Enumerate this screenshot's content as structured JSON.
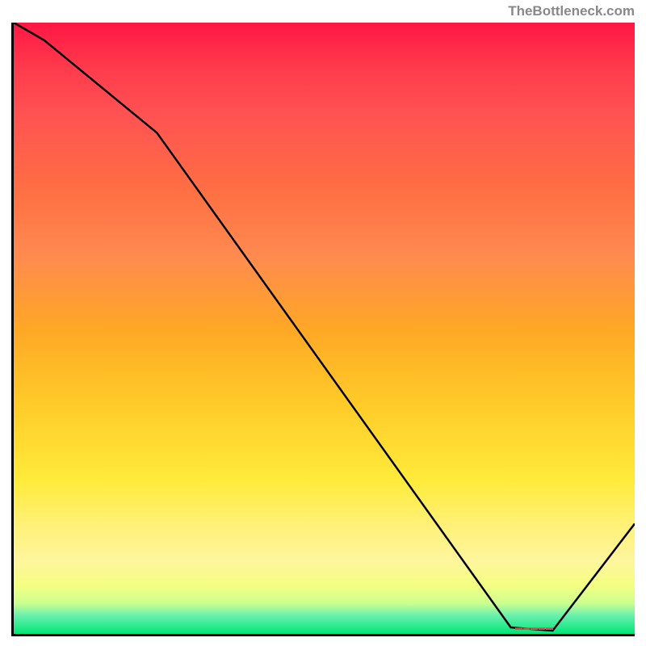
{
  "watermark": "TheBottleneck.com",
  "marker_text": "▬▬▬▬▬",
  "chart_data": {
    "type": "line",
    "title": "",
    "xlabel": "",
    "ylabel": "",
    "x": [
      0,
      5,
      23,
      80,
      87,
      100
    ],
    "values": [
      100,
      97,
      82,
      1,
      0.5,
      18
    ],
    "xlim": [
      0,
      100
    ],
    "ylim": [
      0,
      100
    ],
    "marker_x": 83,
    "marker_y": 0.5,
    "background_gradient": {
      "top_color": "#ff1744",
      "bottom_color": "#00e676"
    }
  }
}
